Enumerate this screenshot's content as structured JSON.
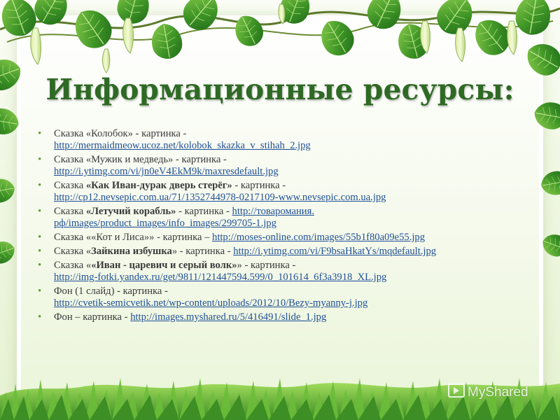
{
  "slide": {
    "title": "Информационные ресурсы:",
    "watermark": "MyShared",
    "items": [
      {
        "pre": "Сказка «Колобок» - картинка - ",
        "bold": "",
        "post": "",
        "link1": "http://mermaidmeow.ucoz.net/kolobok_skazka_v_stihah_2.jpg",
        "link2": ""
      },
      {
        "pre": "Сказка «Мужик и медведь» - картинка - ",
        "bold": "",
        "post": "",
        "link1": "http://i.ytimg.com/vi/jn0eV4EkM9k/maxresdefault.jpg",
        "link2": ""
      },
      {
        "pre": "Сказка ",
        "bold": "«Как Иван-дурак дверь стерёг»",
        "post": " - картинка - ",
        "link1": "http://cp12.nevsepic.com.ua/71/1352744978-0217109-www.nevsepic.com.ua.jpg",
        "link2": ""
      },
      {
        "pre": "Сказка ",
        "bold": "«Летучий корабль»",
        "post": " - картинка - ",
        "link1": "http://товаромания.",
        "link2": "рф/images/product_images/info_images/299705-1.jpg"
      },
      {
        "pre": "Сказка ««Кот и Лиса»» - картинка – ",
        "bold": "",
        "post": "",
        "link1": "http://moses-online.com/images/55b1f80a09e55.jpg",
        "link2": ""
      },
      {
        "pre": "Сказка «",
        "bold": "Зайкина избушка",
        "post": "» - картинка - ",
        "link1": "http://i.ytimg.com/vi/F9bsaHkatYs/mqdefault.jpg",
        "link2": ""
      },
      {
        "pre": "Сказка «",
        "bold": "«Иван - царевич и серый волк»",
        "post": "» - картинка - ",
        "link1": "http://img-fotki.yandex.ru/get/9811/121447594.599/0_101614_6f3a3918_XL.jpg",
        "link2": ""
      },
      {
        "pre": "Фон (1 слайд) - картинка - ",
        "bold": "",
        "post": "",
        "link1": "http://cvetik-semicvetik.net/wp-content/uploads/2012/10/Bezy-myanny-j.jpg",
        "link2": ""
      },
      {
        "pre": "Фон – картинка - ",
        "bold": "",
        "post": "",
        "link1": "http://images.myshared.ru/5/416491/slide_1.jpg",
        "link2": ""
      }
    ]
  },
  "colors": {
    "title": "#2f6a25",
    "text": "#3a3a3a",
    "link": "#1f4f96",
    "leaf": "#4f9a2c",
    "grass": "#5aa833"
  },
  "icons": [
    "leaf-garland-decoration",
    "grass-decoration",
    "bullet-icon",
    "play-icon"
  ]
}
